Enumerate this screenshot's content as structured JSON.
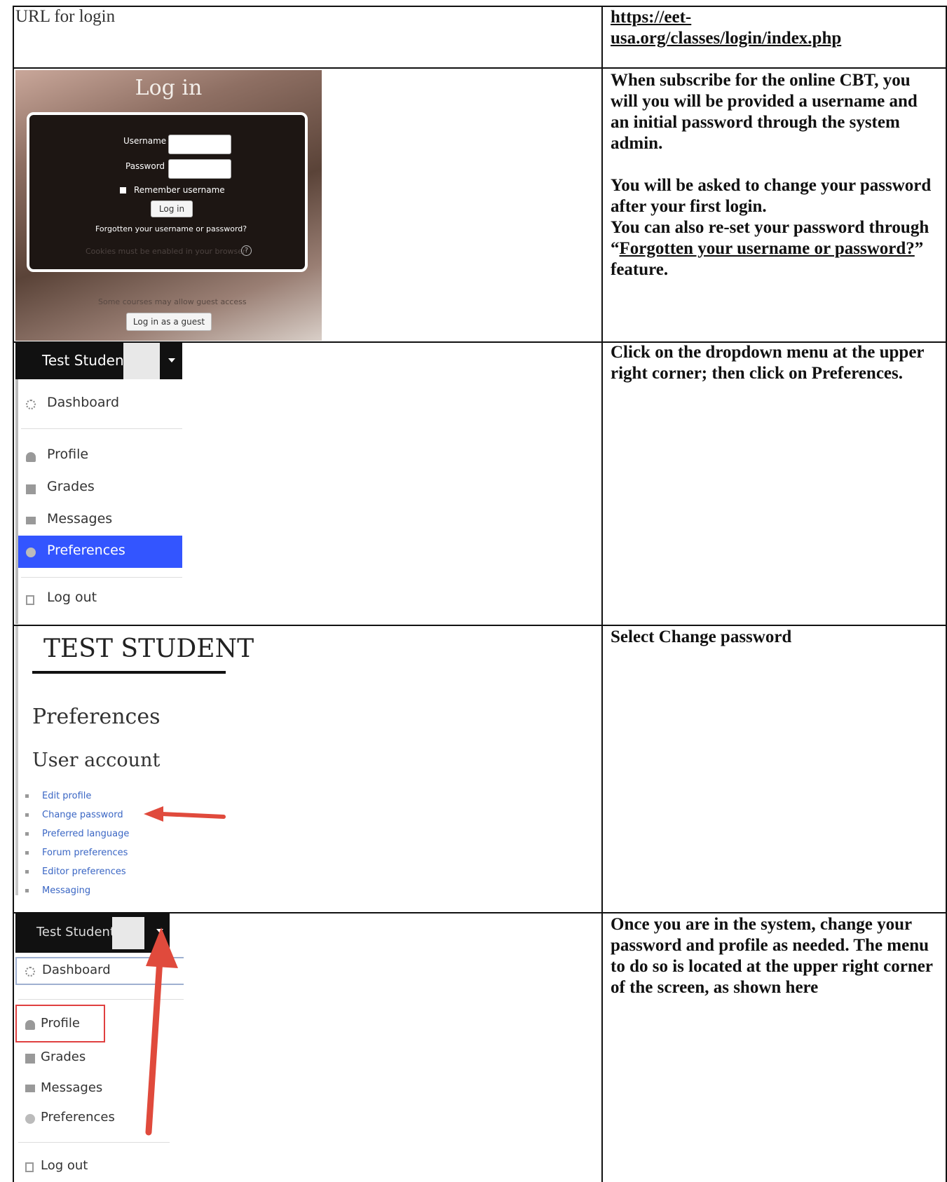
{
  "row1": {
    "label": "URL for login",
    "url_line1": "https://eet-",
    "url_line2": "usa.org/classes/login/index.php"
  },
  "login_screen": {
    "title": "Log in",
    "username_label": "Username",
    "password_label": "Password",
    "remember_label": "Remember username",
    "login_button": "Log in",
    "forgot_link": "Forgotten your username or password?",
    "cookies_note": "Cookies must be enabled in your browser",
    "guest_note": "Some courses may allow guest access",
    "guest_button": "Log in as a guest"
  },
  "row2_text": {
    "p1": "When subscribe for the online CBT, you will you will be provided a username and an initial password through the system admin.",
    "p2": "You will be asked to change your password after your first login.",
    "p3_before": "You can also re-set your password through “",
    "p3_link": "Forgotten your username or password?",
    "p3_after": "” feature."
  },
  "menu1": {
    "user_name": "Test Student",
    "items": [
      "Dashboard",
      "Profile",
      "Grades",
      "Messages",
      "Preferences",
      "Log out"
    ],
    "active": "Preferences",
    "active_color": "#3355ff"
  },
  "row3_text": "Click on the dropdown menu at the upper right corner; then click on Preferences.",
  "prefs": {
    "user_heading": "TEST STUDENT",
    "page_heading": "Preferences",
    "section_heading": "User account",
    "links": [
      "Edit profile",
      "Change password",
      "Preferred language",
      "Forum preferences",
      "Editor preferences",
      "Messaging"
    ]
  },
  "row4_text": "Select Change password",
  "menu2": {
    "user_name": "Test Student",
    "items": [
      "Dashboard",
      "Profile",
      "Grades",
      "Messages",
      "Preferences",
      "Log out"
    ],
    "highlight_color": "#e04040"
  },
  "row5_text": "Once you are in the system, change your password and profile as needed.  The menu to do so is located at the upper right corner of the screen, as shown here"
}
